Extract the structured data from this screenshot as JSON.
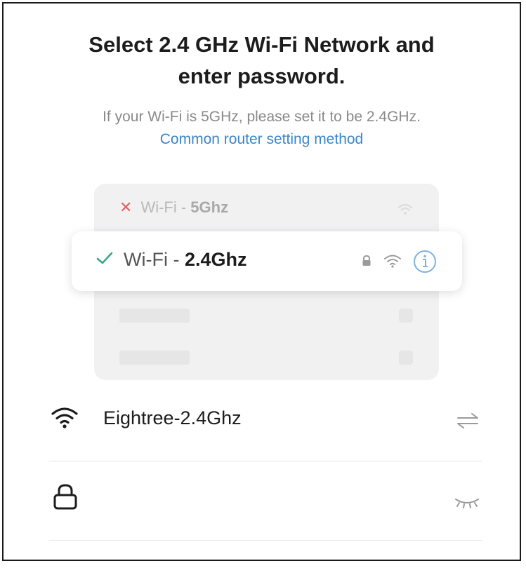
{
  "header": {
    "title_line1": "Select 2.4 GHz Wi-Fi Network and",
    "title_line2": "enter password.",
    "subtitle": "If your Wi-Fi is 5GHz, please set it to be 2.4GHz.",
    "link": "Common router setting method"
  },
  "illustration": {
    "bad_network": {
      "prefix": "Wi-Fi - ",
      "band": "5Ghz",
      "status_icon": "x-icon"
    },
    "good_network": {
      "prefix": "Wi-Fi - ",
      "band": "2.4Ghz",
      "status_icon": "check-icon"
    }
  },
  "form": {
    "wifi_name": "Eightree-2.4Ghz",
    "password": ""
  },
  "colors": {
    "link": "#3a86c8",
    "error": "#e0625e",
    "success": "#3aa68a"
  }
}
